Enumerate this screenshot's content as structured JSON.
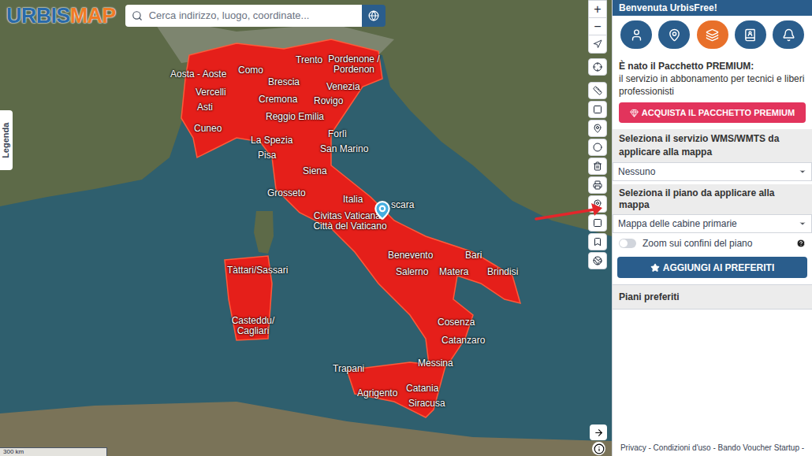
{
  "header": {
    "logo": [
      "URBIS",
      "MAP"
    ],
    "search": {
      "placeholder": "Cerca indirizzo, luogo, coordinate..."
    }
  },
  "legend_tab": "Legenda",
  "map_controls": {
    "zoom_in": "+",
    "zoom_out": "−"
  },
  "map": {
    "labels": [
      "Aosta - Aoste",
      "Como",
      "Trento",
      "Pordenone / Pordenon",
      "Brescia",
      "Vercelli",
      "Venezia",
      "Asti",
      "Cremona",
      "Rovigo",
      "Reggio Emilia",
      "Cuneo",
      "La Spezia",
      "Forlì",
      "San Marino",
      "Pisa",
      "Siena",
      "Grosseto",
      "Italia",
      "scara",
      "Civitas Vaticana - Città del Vaticano",
      "Benevento",
      "Bari",
      "Salerno",
      "Matera",
      "Brindisi",
      "Tàttari/Sassari",
      "Casteddu/ Cagliari",
      "Cosenza",
      "Catanzaro",
      "Trapani",
      "Messina",
      "Agrigento",
      "Catania",
      "Siracusa"
    ],
    "scale": "300 km"
  },
  "panel": {
    "title": "Benvenuta UrbisFree!",
    "nav": [
      {
        "selected": false
      },
      {
        "selected": false
      },
      {
        "selected": true
      },
      {
        "selected": false
      },
      {
        "selected": false
      }
    ],
    "premium": {
      "title": "È nato il Pacchetto PREMIUM:",
      "text": "il servizio in abbonamento per tecnici e liberi professionisti",
      "button": "ACQUISTA IL PACCHETTO PREMIUM"
    },
    "wms": {
      "label": "Seleziona il servizio WMS/WMTS da applicare alla mappa",
      "value": "Nessuno"
    },
    "plan": {
      "label": "Seleziona il piano da applicare alla mappa",
      "value": "Mappa delle cabine primarie"
    },
    "toggle": {
      "label": "Zoom sui confini del piano",
      "on": false
    },
    "favorite_button": "AGGIUNGI AI PREFERITI",
    "favorites": {
      "title": "Piani preferiti"
    },
    "footer": "Privacy - Condizioni d'uso - Bando Voucher Startup -"
  }
}
